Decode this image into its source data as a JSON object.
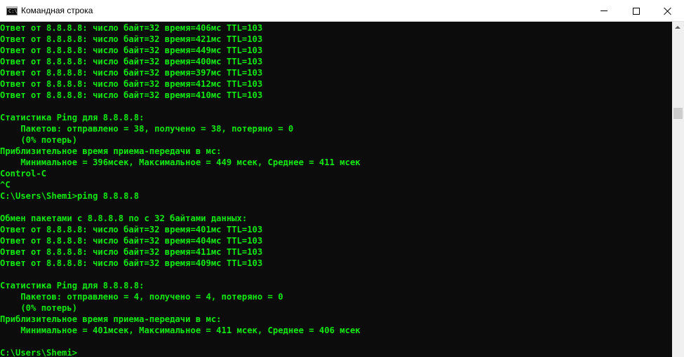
{
  "window": {
    "title": "Командная строка",
    "icon": "cmd-icon",
    "icon_prompt": "C:\\"
  },
  "controls": {
    "minimize": "minimize-icon",
    "maximize": "maximize-icon",
    "close": "close-icon"
  },
  "console": {
    "text_color": "#13e813",
    "background": "#0c0c0c",
    "lines": [
      "Ответ от 8.8.8.8: число байт=32 время=406мс TTL=103",
      "Ответ от 8.8.8.8: число байт=32 время=421мс TTL=103",
      "Ответ от 8.8.8.8: число байт=32 время=449мс TTL=103",
      "Ответ от 8.8.8.8: число байт=32 время=400мс TTL=103",
      "Ответ от 8.8.8.8: число байт=32 время=397мс TTL=103",
      "Ответ от 8.8.8.8: число байт=32 время=412мс TTL=103",
      "Ответ от 8.8.8.8: число байт=32 время=410мс TTL=103",
      "",
      "Статистика Ping для 8.8.8.8:",
      "    Пакетов: отправлено = 38, получено = 38, потеряно = 0",
      "    (0% потерь)",
      "Приблизительное время приема-передачи в мс:",
      "    Минимальное = 396мсек, Максимальное = 449 мсек, Среднее = 411 мсек",
      "Control-C",
      "^C",
      "C:\\Users\\Shemi>ping 8.8.8.8",
      "",
      "Обмен пакетами с 8.8.8.8 по с 32 байтами данных:",
      "Ответ от 8.8.8.8: число байт=32 время=401мс TTL=103",
      "Ответ от 8.8.8.8: число байт=32 время=404мс TTL=103",
      "Ответ от 8.8.8.8: число байт=32 время=411мс TTL=103",
      "Ответ от 8.8.8.8: число байт=32 время=409мс TTL=103",
      "",
      "Статистика Ping для 8.8.8.8:",
      "    Пакетов: отправлено = 4, получено = 4, потеряно = 0",
      "    (0% потерь)",
      "Приблизительное время приема-передачи в мс:",
      "    Минимальное = 401мсек, Максимальное = 411 мсек, Среднее = 406 мсек",
      "",
      "C:\\Users\\Shemi>"
    ]
  },
  "scrollbar": {
    "up_arrow": "scroll-up-arrow-icon"
  }
}
